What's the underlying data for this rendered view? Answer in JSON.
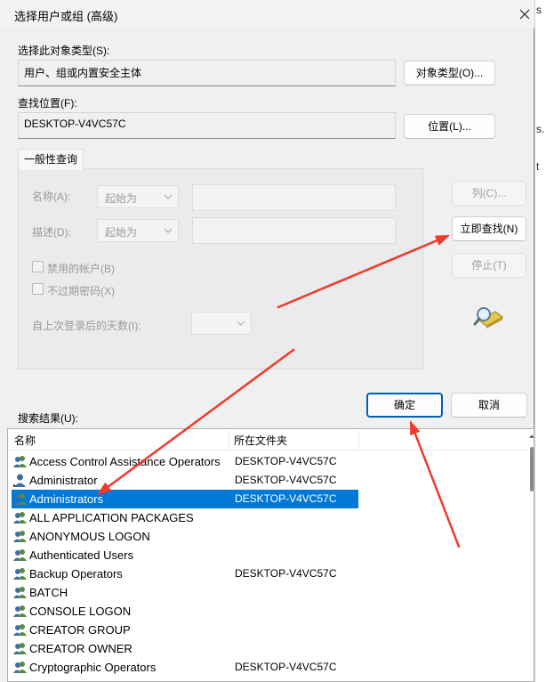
{
  "dialog": {
    "title": "选择用户或组 (高级)"
  },
  "object_type": {
    "label": "选择此对象类型(S):",
    "value": "用户、组或内置安全主体",
    "button": "对象类型(O)..."
  },
  "location": {
    "label": "查找位置(F):",
    "value": "DESKTOP-V4VC57C",
    "button": "位置(L)..."
  },
  "query": {
    "tab_label": "一般性查询",
    "name_label": "名称(A):",
    "name_mode": "起始为",
    "desc_label": "描述(D):",
    "desc_mode": "起始为",
    "disabled_accounts": "禁用的帐户(B)",
    "non_expiring_pw": "不过期密码(X)",
    "days_since_logon": "自上次登录后的天数(I):"
  },
  "side_buttons": {
    "columns": "列(C)...",
    "find_now": "立即查找(N)",
    "stop": "停止(T)"
  },
  "actions": {
    "ok": "确定",
    "cancel": "取消"
  },
  "results": {
    "label": "搜索结果(U):",
    "columns": [
      "名称",
      "所在文件夹"
    ],
    "rows": [
      {
        "name": "Access Control Assistance Operators",
        "folder": "DESKTOP-V4VC57C",
        "icon": "group-icon"
      },
      {
        "name": "Administrator",
        "folder": "DESKTOP-V4VC57C",
        "icon": "user-icon"
      },
      {
        "name": "Administrators",
        "folder": "DESKTOP-V4VC57C",
        "icon": "group-icon",
        "selected": true
      },
      {
        "name": "ALL APPLICATION PACKAGES",
        "folder": "",
        "icon": "group-icon"
      },
      {
        "name": "ANONYMOUS LOGON",
        "folder": "",
        "icon": "group-icon"
      },
      {
        "name": "Authenticated Users",
        "folder": "",
        "icon": "group-icon"
      },
      {
        "name": "Backup Operators",
        "folder": "DESKTOP-V4VC57C",
        "icon": "group-icon"
      },
      {
        "name": "BATCH",
        "folder": "",
        "icon": "group-icon"
      },
      {
        "name": "CONSOLE LOGON",
        "folder": "",
        "icon": "group-icon"
      },
      {
        "name": "CREATOR GROUP",
        "folder": "",
        "icon": "group-icon"
      },
      {
        "name": "CREATOR OWNER",
        "folder": "",
        "icon": "group-icon"
      },
      {
        "name": "Cryptographic Operators",
        "folder": "DESKTOP-V4VC57C",
        "icon": "group-icon"
      }
    ]
  },
  "colors": {
    "selection": "#0078d7",
    "accent_border": "#005fb8",
    "annotation_arrow": "#ee3b2b"
  }
}
